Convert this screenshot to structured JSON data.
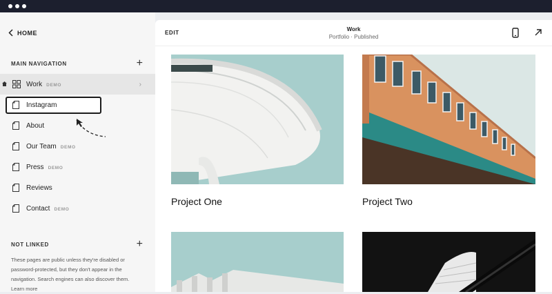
{
  "sidebar": {
    "home_label": "HOME",
    "main_nav_label": "MAIN NAVIGATION",
    "items": [
      {
        "label": "Work",
        "tag": "DEMO"
      },
      {
        "label": "Instagram",
        "tag": ""
      },
      {
        "label": "About",
        "tag": ""
      },
      {
        "label": "Our Team",
        "tag": "DEMO"
      },
      {
        "label": "Press",
        "tag": "DEMO"
      },
      {
        "label": "Reviews",
        "tag": ""
      },
      {
        "label": "Contact",
        "tag": "DEMO"
      }
    ],
    "not_linked_label": "NOT LINKED",
    "not_linked_note": "These pages are public unless they're disabled or password-protected, but they don't appear in the navigation. Search engines can also discover them. Learn more"
  },
  "header": {
    "edit_label": "EDIT",
    "title": "Work",
    "subtitle": "Portfolio · Published"
  },
  "projects": [
    {
      "caption": "Project One"
    },
    {
      "caption": "Project Two"
    }
  ],
  "icons": {
    "back": "chevron-left-icon",
    "add": "plus-icon",
    "page": "page-icon",
    "grid": "grid-icon",
    "home_indicator": "home-icon",
    "mobile": "mobile-icon",
    "open": "arrow-up-right-icon"
  },
  "colors": {
    "topbar": "#1c1f2e",
    "sidebar_bg": "#f6f6f6",
    "active_row": "#e6e6e6"
  }
}
